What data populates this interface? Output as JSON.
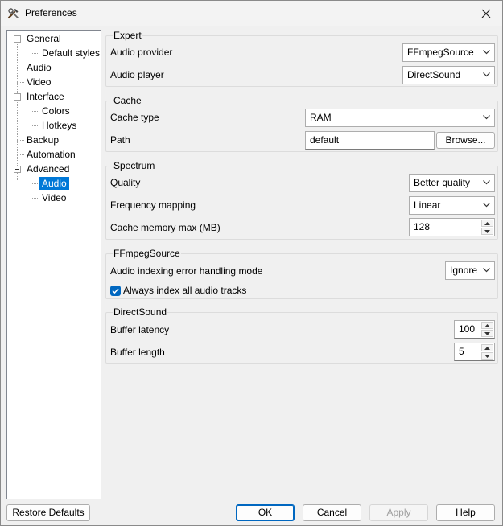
{
  "window": {
    "title": "Preferences"
  },
  "tree": {
    "items": [
      {
        "label": "General",
        "level": 0,
        "expanded": true
      },
      {
        "label": "Default styles",
        "level": 1
      },
      {
        "label": "Audio",
        "level": 0
      },
      {
        "label": "Video",
        "level": 0
      },
      {
        "label": "Interface",
        "level": 0,
        "expanded": true
      },
      {
        "label": "Colors",
        "level": 1
      },
      {
        "label": "Hotkeys",
        "level": 1
      },
      {
        "label": "Backup",
        "level": 0
      },
      {
        "label": "Automation",
        "level": 0
      },
      {
        "label": "Advanced",
        "level": 0,
        "expanded": true
      },
      {
        "label": "Audio",
        "level": 1,
        "selected": true
      },
      {
        "label": "Video",
        "level": 1
      }
    ]
  },
  "expert": {
    "title": "Expert",
    "audio_provider_label": "Audio provider",
    "audio_provider_value": "FFmpegSource",
    "audio_player_label": "Audio player",
    "audio_player_value": "DirectSound"
  },
  "cache": {
    "title": "Cache",
    "cache_type_label": "Cache type",
    "cache_type_value": "RAM",
    "path_label": "Path",
    "path_value": "default",
    "browse_label": "Browse..."
  },
  "spectrum": {
    "title": "Spectrum",
    "quality_label": "Quality",
    "quality_value": "Better quality",
    "frequency_mapping_label": "Frequency mapping",
    "frequency_mapping_value": "Linear",
    "cache_memory_label": "Cache memory max (MB)",
    "cache_memory_value": "128"
  },
  "ffmpegsource": {
    "title": "FFmpegSource",
    "error_mode_label": "Audio indexing error handling mode",
    "error_mode_value": "Ignore",
    "index_all_label": "Always index all audio tracks",
    "index_all_checked": true
  },
  "directsound": {
    "title": "DirectSound",
    "buffer_latency_label": "Buffer latency",
    "buffer_latency_value": "100",
    "buffer_length_label": "Buffer length",
    "buffer_length_value": "5"
  },
  "footer": {
    "restore_defaults": "Restore Defaults",
    "ok": "OK",
    "cancel": "Cancel",
    "apply": "Apply",
    "help": "Help"
  },
  "colors": {
    "selection": "#0078d7",
    "accent": "#0067c0"
  }
}
